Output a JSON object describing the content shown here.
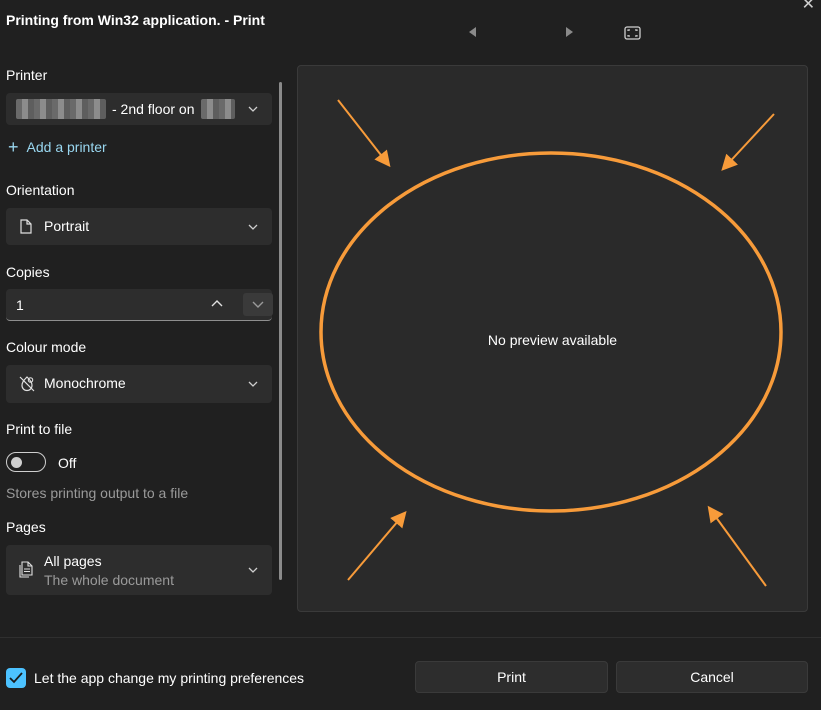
{
  "window": {
    "title": "Printing from Win32 application. - Print"
  },
  "printer": {
    "label": "Printer",
    "selected_visible": "- 2nd floor on",
    "add_printer": "Add a printer"
  },
  "orientation": {
    "label": "Orientation",
    "value": "Portrait"
  },
  "copies": {
    "label": "Copies",
    "value": "1"
  },
  "colour_mode": {
    "label": "Colour mode",
    "value": "Monochrome"
  },
  "print_to_file": {
    "label": "Print to file",
    "state": "Off",
    "helper": "Stores printing output to a file"
  },
  "pages": {
    "label": "Pages",
    "value": "All pages",
    "subtitle": "The whole document"
  },
  "preview": {
    "message": "No preview available",
    "annotation_color": "#f79b3a"
  },
  "footer": {
    "checkbox_label": "Let the app change my printing preferences",
    "checkbox_checked": true,
    "print_button": "Print",
    "cancel_button": "Cancel"
  },
  "colors": {
    "background": "#202020",
    "control": "#2d2d2d",
    "accent": "#4cc2ff",
    "link": "#99d7f0"
  },
  "icons": [
    "close-icon",
    "previous-page-icon",
    "next-page-icon",
    "fit-page-icon",
    "chevron-down-icon",
    "plus-icon",
    "document-icon",
    "colour-mode-icon",
    "chevron-up-icon",
    "pages-icon",
    "checkmark-icon"
  ]
}
